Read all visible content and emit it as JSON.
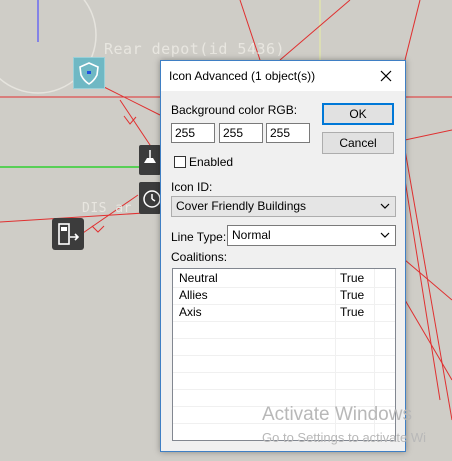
{
  "map": {
    "labels": {
      "rear_depot": "Rear depot(id 5436)",
      "dis_clipped": "DIS ar"
    }
  },
  "dialog": {
    "title": "Icon Advanced (1 object(s))",
    "background_color_label": "Background color RGB:",
    "rgb": {
      "r": "255",
      "g": "255",
      "b": "255"
    },
    "ok_label": "OK",
    "cancel_label": "Cancel",
    "enabled_label": "Enabled",
    "enabled_checked": false,
    "icon_id_label": "Icon ID:",
    "icon_id_value": "Cover Friendly Buildings",
    "line_type_label": "Line Type:",
    "line_type_value": "Normal",
    "coalitions_label": "Coalitions:",
    "coalitions": [
      {
        "name": "Neutral",
        "value": "True"
      },
      {
        "name": "Allies",
        "value": "True"
      },
      {
        "name": "Axis",
        "value": "True"
      }
    ]
  },
  "watermark": {
    "line1": "Activate Windows",
    "line2": "Go to Settings to activate Wi"
  },
  "colors": {
    "map_bg": "#cfcdc7",
    "red_lines": "#e03030",
    "green_line": "#30d030",
    "accent": "#0078d7"
  }
}
